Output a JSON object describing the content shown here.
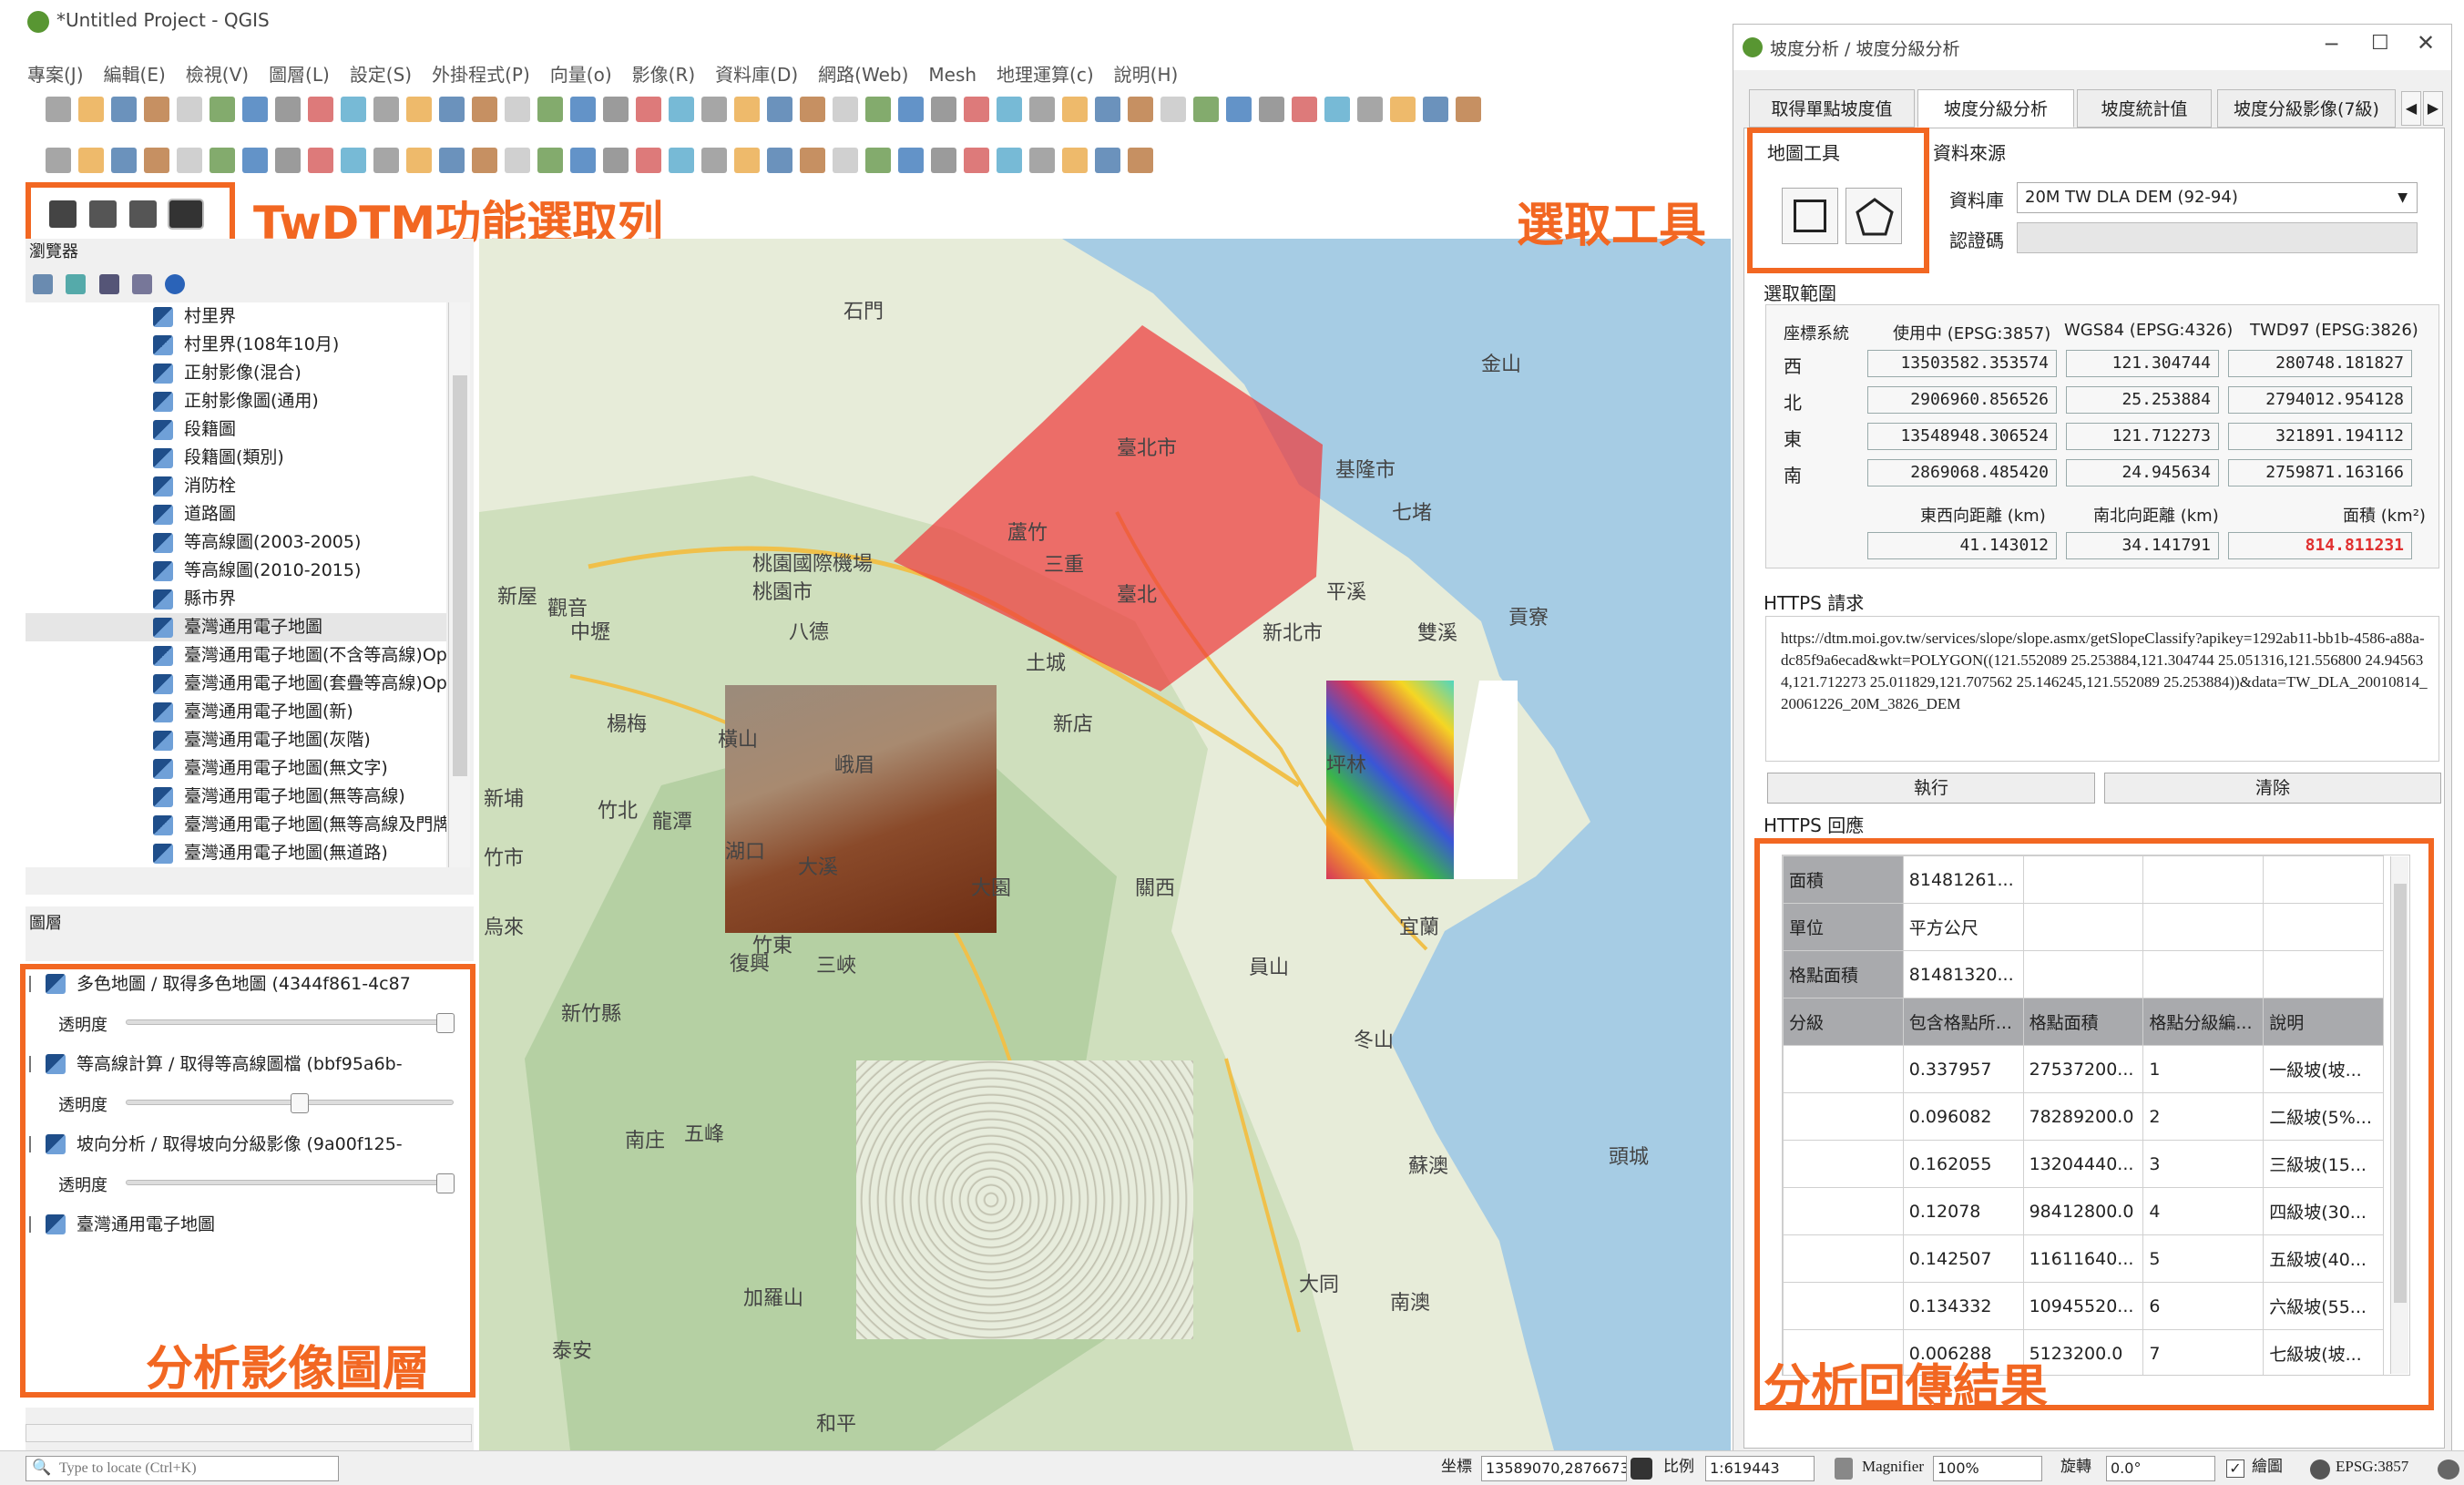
{
  "window": {
    "title": "*Untitled Project - QGIS"
  },
  "menu": [
    "專案(J)",
    "編輯(E)",
    "檢視(V)",
    "圖層(L)",
    "設定(S)",
    "外掛程式(P)",
    "向量(o)",
    "影像(R)",
    "資料庫(D)",
    "網路(Web)",
    "Mesh",
    "地理運算(c)",
    "說明(H)"
  ],
  "annotations": {
    "toolbar_label": "TwDTM功能選取列",
    "select_tool_label": "選取工具",
    "layers_label": "分析影像圖層",
    "response_label": "分析回傳結果"
  },
  "browser": {
    "title": "瀏覽器",
    "items": [
      "村里界",
      "村里界(108年10月)",
      "正射影像(混合)",
      "正射影像圖(通用)",
      "段籍圖",
      "段籍圖(類別)",
      "消防栓",
      "道路圖",
      "等高線圖(2003-2005)",
      "等高線圖(2010-2015)",
      "縣市界",
      "臺灣通用電子地圖",
      "臺灣通用電子地圖(不含等高線)Op",
      "臺灣通用電子地圖(套疊等高線)Op",
      "臺灣通用電子地圖(新)",
      "臺灣通用電子地圖(灰階)",
      "臺灣通用電子地圖(無文字)",
      "臺灣通用電子地圖(無等高線)",
      "臺灣通用電子地圖(無等高線及門牌",
      "臺灣通用電子地圖(無道路)"
    ]
  },
  "layers": {
    "title": "圖層",
    "items": [
      {
        "name": "多色地圖 / 取得多色地圖 (4344f861-4c87",
        "has_slider": true
      },
      {
        "name": "等高線計算 / 取得等高線圖檔 (bbf95a6b-",
        "has_slider": true
      },
      {
        "name": "坡向分析 / 取得坡向分級影像 (9a00f125-",
        "has_slider": true
      },
      {
        "name": "臺灣通用電子地圖",
        "has_slider": false
      }
    ],
    "opacity_label": "透明度"
  },
  "map": {
    "labels": [
      "石門",
      "金山",
      "臺北市",
      "基隆市",
      "七堵",
      "桃園市",
      "蘆竹",
      "桃園國際機場",
      "新屋",
      "觀音",
      "中壢",
      "八德",
      "土城",
      "三重",
      "臺北",
      "新北市",
      "平溪",
      "雙溪",
      "貢寮",
      "新店",
      "坪林",
      "楊梅",
      "龍潭",
      "竹北",
      "新埔",
      "關西",
      "烏來",
      "竹東",
      "三峽",
      "宜蘭",
      "員山",
      "新竹縣",
      "頭城",
      "五峰",
      "南庄",
      "南澳",
      "加羅山",
      "泰安",
      "和平",
      "冬山",
      "蘇澳",
      "大同",
      "竹市",
      "復興",
      "峨眉",
      "橫山",
      "湖口",
      "大溪",
      "大園"
    ]
  },
  "dialog": {
    "title": "坡度分析 / 坡度分級分析",
    "tabs": [
      "取得單點坡度值",
      "坡度分級分析",
      "坡度統計值",
      "坡度分級影像(7級)"
    ],
    "map_tools_label": "地圖工具",
    "source_label": "資料來源",
    "db_label": "資料庫",
    "db_value": "20M TW DLA DEM (92-94)",
    "auth_label": "認證碼",
    "range_label": "選取範圍",
    "coord_headers": [
      "座標系統",
      "使用中 (EPSG:3857)",
      "WGS84 (EPSG:4326)",
      "TWD97 (EPSG:3826)"
    ],
    "coord_rows": [
      {
        "label": "西",
        "v": [
          "13503582.353574",
          "121.304744",
          "280748.181827"
        ]
      },
      {
        "label": "北",
        "v": [
          "2906960.856526",
          "25.253884",
          "2794012.954128"
        ]
      },
      {
        "label": "東",
        "v": [
          "13548948.306524",
          "121.712273",
          "321891.194112"
        ]
      },
      {
        "label": "南",
        "v": [
          "2869068.485420",
          "24.945634",
          "2759871.163166"
        ]
      }
    ],
    "dist_headers": [
      "東西向距離 (km)",
      "南北向距離 (km)",
      "面積 (km²)"
    ],
    "dist_values": [
      "41.143012",
      "34.141791",
      "814.811231"
    ],
    "request_label": "HTTPS 請求",
    "request_text": "https://dtm.moi.gov.tw/services/slope/slope.asmx/getSlopeClassify?apikey=1292ab11-bb1b-4586-a88a-dc85f9a6ecad&wkt=POLYGON((121.552089 25.253884,121.304744 25.051316,121.556800 24.945634,121.712273 25.011829,121.707562 25.146245,121.552089 25.253884))&data=TW_DLA_20010814_20061226_20M_3826_DEM",
    "run_label": "執行",
    "clear_label": "清除",
    "response_label": "HTTPS 回應",
    "resp_top": [
      {
        "k": "面積",
        "v": "81481261..."
      },
      {
        "k": "單位",
        "v": "平方公尺"
      },
      {
        "k": "格點面積",
        "v": "81481320..."
      }
    ],
    "resp_headers": [
      "分級",
      "包含格點所...",
      "格點面積",
      "格點分級編...",
      "說明"
    ],
    "resp_rows": [
      [
        "",
        "0.337957",
        "27537200...",
        "1",
        "一級坡(坡..."
      ],
      [
        "",
        "0.096082",
        "78289200.0",
        "2",
        "二級坡(5%..."
      ],
      [
        "",
        "0.162055",
        "13204440...",
        "3",
        "三級坡(15..."
      ],
      [
        "",
        "0.12078",
        "98412800.0",
        "4",
        "四級坡(30..."
      ],
      [
        "",
        "0.142507",
        "11611640...",
        "5",
        "五級坡(40..."
      ],
      [
        "",
        "0.134332",
        "10945520...",
        "6",
        "六級坡(55..."
      ],
      [
        "",
        "0.006288",
        "5123200.0",
        "7",
        "七級坡(坡..."
      ]
    ]
  },
  "statusbar": {
    "locate_placeholder": "Type to locate (Ctrl+K)",
    "coord_label": "坐標",
    "coord_value": "13589070,2876673",
    "scale_label": "比例",
    "scale_value": "1:619443",
    "magnifier_label": "Magnifier",
    "magnifier_value": "100%",
    "rotation_label": "旋轉",
    "rotation_value": "0.0°",
    "render_label": "繪圖",
    "crs_label": "EPSG:3857"
  },
  "colors": {
    "accent": "#f26722",
    "selection": "#ee3b3b"
  }
}
